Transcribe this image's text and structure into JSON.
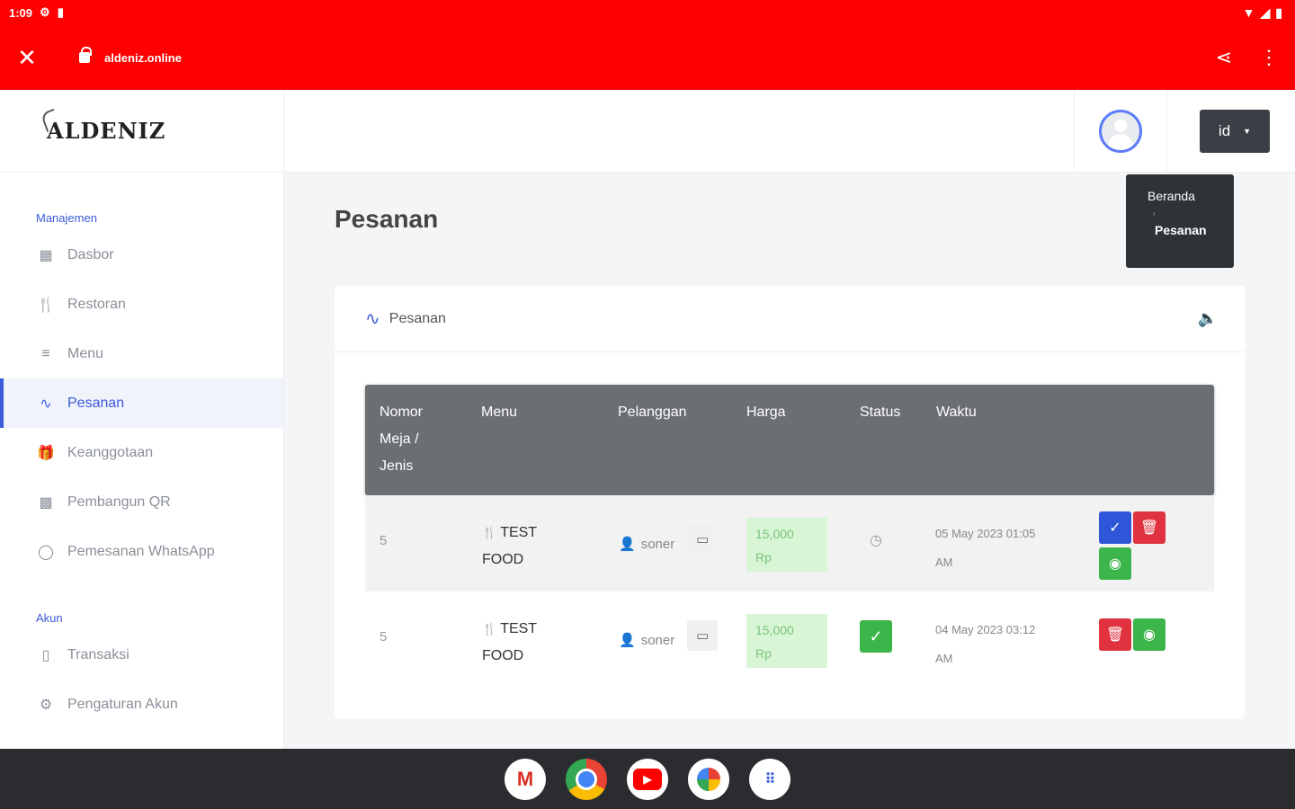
{
  "status_bar": {
    "time": "1:09"
  },
  "browser": {
    "url": "aldeniz.online"
  },
  "brand": {
    "name": "ALDENIZ"
  },
  "sidebar": {
    "section_manage": "Manajemen",
    "items": [
      {
        "label": "Dasbor",
        "icon": "dashboard-icon"
      },
      {
        "label": "Restoran",
        "icon": "restaurant-icon"
      },
      {
        "label": "Menu",
        "icon": "menu-list-icon"
      },
      {
        "label": "Pesanan",
        "icon": "activity-icon",
        "active": true
      },
      {
        "label": "Keanggotaan",
        "icon": "gift-icon"
      },
      {
        "label": "Pembangun QR",
        "icon": "qr-icon"
      },
      {
        "label": "Pemesanan WhatsApp",
        "icon": "whatsapp-icon"
      }
    ],
    "section_account": "Akun",
    "account_items": [
      {
        "label": "Transaksi",
        "icon": "document-icon"
      },
      {
        "label": "Pengaturan Akun",
        "icon": "gear-icon"
      }
    ]
  },
  "header": {
    "language": "id"
  },
  "breadcrumb": {
    "home": "Beranda",
    "current": "Pesanan"
  },
  "page": {
    "title": "Pesanan"
  },
  "card": {
    "title": "Pesanan"
  },
  "table": {
    "headers": {
      "no_line1": "Nomor",
      "no_line2": "Meja /",
      "no_line3": "Jenis",
      "menu": "Menu",
      "customer": "Pelanggan",
      "price": "Harga",
      "status": "Status",
      "time": "Waktu"
    },
    "rows": [
      {
        "no": "5",
        "menu_line1": "TEST",
        "menu_line2": "FOOD",
        "customer": "soner",
        "price_line1": "15,000",
        "price_line2": "Rp",
        "status": "pending",
        "time_line1": "05 May 2023 01:05",
        "time_line2": "AM"
      },
      {
        "no": "5",
        "menu_line1": "TEST",
        "menu_line2": "FOOD",
        "customer": "soner",
        "price_line1": "15,000",
        "price_line2": "Rp",
        "status": "done",
        "time_line1": "04 May 2023 03:12",
        "time_line2": "AM"
      }
    ]
  },
  "colors": {
    "brand_red": "#ff0000",
    "accent": "#3b5bdb",
    "success": "#3cb54a",
    "danger": "#e0323f"
  }
}
